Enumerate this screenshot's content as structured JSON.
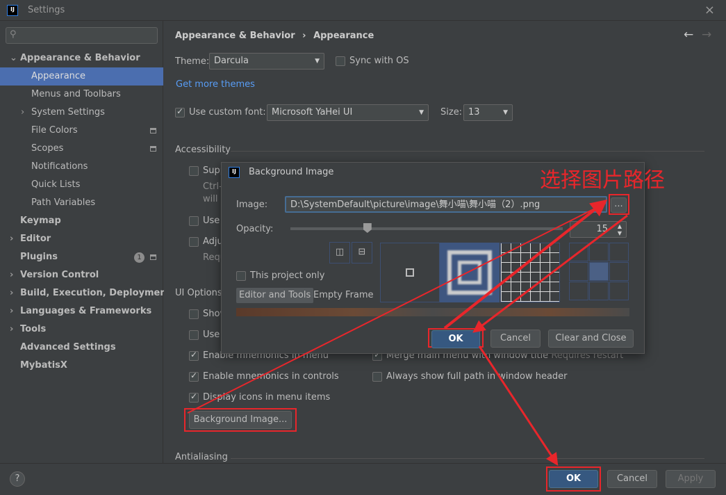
{
  "window": {
    "title": "Settings",
    "close": "×"
  },
  "sidebar": {
    "search_placeholder": "",
    "items": [
      {
        "label": "Appearance & Behavior",
        "expanded": true,
        "bold": true
      },
      {
        "label": "Appearance",
        "selected": true
      },
      {
        "label": "Menus and Toolbars"
      },
      {
        "label": "System Settings",
        "collapsed": true
      },
      {
        "label": "File Colors",
        "project_icon": true
      },
      {
        "label": "Scopes",
        "project_icon": true
      },
      {
        "label": "Notifications"
      },
      {
        "label": "Quick Lists"
      },
      {
        "label": "Path Variables"
      },
      {
        "label": "Keymap",
        "bold": true
      },
      {
        "label": "Editor",
        "bold": true,
        "collapsed": true
      },
      {
        "label": "Plugins",
        "bold": true,
        "badge": "1",
        "project_icon": true
      },
      {
        "label": "Version Control",
        "bold": true,
        "collapsed": true
      },
      {
        "label": "Build, Execution, Deployment",
        "bold": true,
        "collapsed": true
      },
      {
        "label": "Languages & Frameworks",
        "bold": true,
        "collapsed": true
      },
      {
        "label": "Tools",
        "bold": true,
        "collapsed": true
      },
      {
        "label": "Advanced Settings",
        "bold": true
      },
      {
        "label": "MybatisX",
        "bold": true
      }
    ]
  },
  "main": {
    "breadcrumb": [
      "Appearance & Behavior",
      "Appearance"
    ],
    "breadcrumb_sep": "›",
    "theme_label": "Theme:",
    "theme_value": "Darcula",
    "sync_label": "Sync with OS",
    "more_themes": "Get more themes",
    "custom_font_label": "Use custom font:",
    "font_value": "Microsoft YaHei UI",
    "size_label": "Size:",
    "size_value": "13",
    "accessibility": "Accessibility",
    "acc_fragments": [
      "Supp",
      "Ctrl-",
      "will",
      "Use",
      "Adju",
      "Requ"
    ],
    "ui_options": "UI Options",
    "ui_fragments": [
      "Show",
      "Use"
    ],
    "mnemonics_menu": "Enable mnemonics in menu",
    "mnemonics_controls": "Enable mnemonics in controls",
    "display_icons": "Display icons in menu items",
    "merge_menu": "Merge main menu with window title",
    "requires_restart": "Requires restart",
    "full_path": "Always show full path in window header",
    "bg_image_button": "Background Image...",
    "antialiasing": "Antialiasing"
  },
  "footer": {
    "help": "?",
    "ok": "OK",
    "cancel": "Cancel",
    "apply": "Apply"
  },
  "dialog": {
    "title": "Background Image",
    "image_label": "Image:",
    "image_value": "D:\\SystemDefault\\picture\\image\\舞小喵\\舞小喵（2）.png",
    "browse": "...",
    "opacity_label": "Opacity:",
    "opacity_value": "15",
    "opacity_percent": 15,
    "project_only": "This project only",
    "tabs": [
      "Editor and Tools",
      "Empty Frame"
    ],
    "fill_modes": [
      "center",
      "scale",
      "tile"
    ],
    "anchor_selected": "center",
    "ok": "OK",
    "cancel": "Cancel",
    "clear_close": "Clear and Close"
  },
  "annotation": {
    "text": "选择图片路径",
    "color": "#e8262b"
  },
  "colors": {
    "accent": "#4b6eaf",
    "link": "#589df6",
    "default_button": "#365880"
  }
}
